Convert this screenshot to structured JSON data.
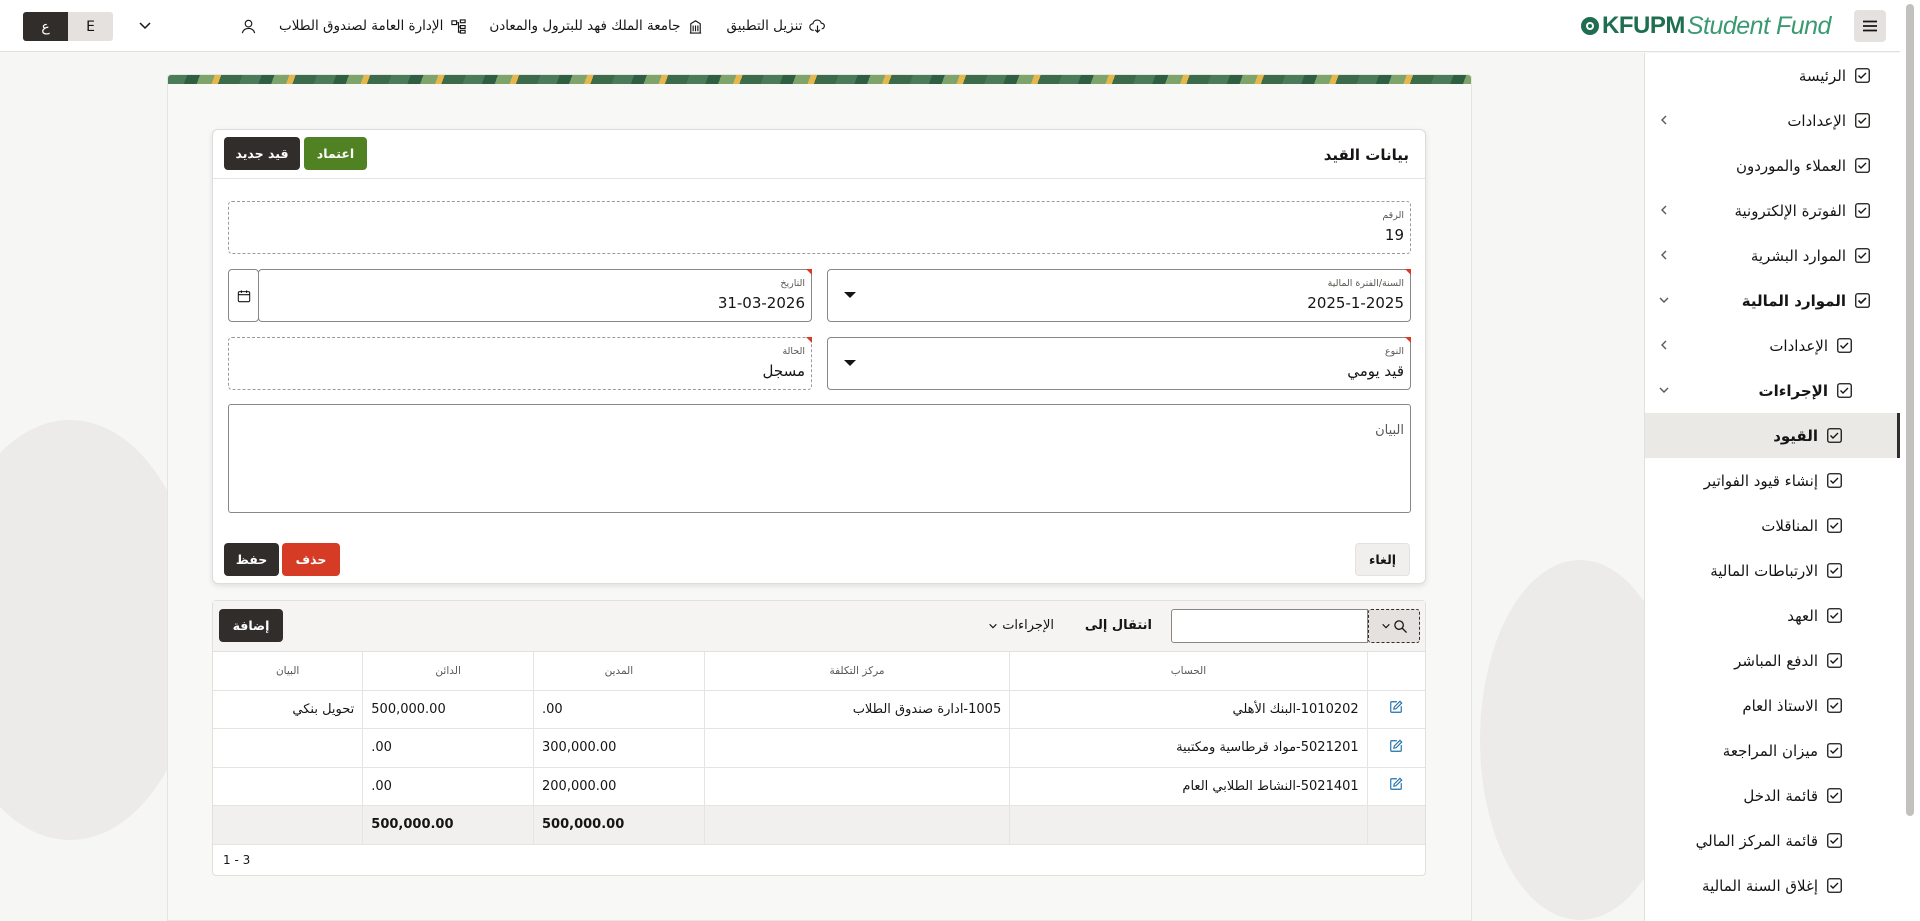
{
  "header": {
    "lang_active": "ع",
    "lang_other": "E",
    "org_label": "الإدارة العامة لصندوق الطلاب",
    "university_label": "جامعة الملك فهد للبترول والمعادن",
    "download_label": "تنزيل التطبيق",
    "logo_primary": "KFUPM",
    "logo_secondary": "Student Fund"
  },
  "sidebar": {
    "items": [
      {
        "label": "الرئيسة"
      },
      {
        "label": "الإعدادات"
      },
      {
        "label": "العملاء والموردون"
      },
      {
        "label": "الفوترة الإلكترونية"
      },
      {
        "label": "الموارد البشرية"
      },
      {
        "label": "الموارد المالية"
      },
      {
        "label": "الإعدادات"
      },
      {
        "label": "الإجراءات"
      },
      {
        "label": "القيود"
      },
      {
        "label": "إنشاء قيود الفواتير"
      },
      {
        "label": "المناقلات"
      },
      {
        "label": "الارتباطات المالية"
      },
      {
        "label": "العهد"
      },
      {
        "label": "الدفع المباشر"
      },
      {
        "label": "الاستاذ العام"
      },
      {
        "label": "ميزان المراجعة"
      },
      {
        "label": "قائمة الدخل"
      },
      {
        "label": "قائمة المركز المالي"
      },
      {
        "label": "إغلاق السنة المالية"
      }
    ]
  },
  "form": {
    "title": "بيانات القيد",
    "approve_button": "اعتماد",
    "new_entry_button": "قيد جديد",
    "number_label": "الرقم",
    "number_value": "19",
    "fiscal_label": "السنة/الفترة المالية",
    "fiscal_value": "2025-1-2025",
    "date_label": "التاريخ",
    "date_value": "31-03-2026",
    "type_label": "النوع",
    "type_value": "قيد يومي",
    "status_label": "الحالة",
    "status_value": "مسجل",
    "description_label": "البيان",
    "cancel_button": "إلغاء",
    "delete_button": "حذف",
    "save_button": "حفظ"
  },
  "grid": {
    "goto_label": "انتقال إلى",
    "actions_label": "الإجراءات",
    "add_button": "إضافة",
    "columns": {
      "account": "الحساب",
      "cost_center": "مركز التكلفة",
      "debit": "المدين",
      "credit": "الدائن",
      "description": "البيان"
    },
    "rows": [
      {
        "account": "1010202-البنك الأهلي",
        "cost_center": "1005-ادارة صندوق الطلاب",
        "debit": ".00",
        "credit": "500,000.00",
        "description": "تحويل بنكي"
      },
      {
        "account": "5021201-مواد قرطاسية ومكتبية",
        "cost_center": "",
        "debit": "300,000.00",
        "credit": ".00",
        "description": ""
      },
      {
        "account": "5021401-النشاط الطلابي العام",
        "cost_center": "",
        "debit": "200,000.00",
        "credit": ".00",
        "description": ""
      }
    ],
    "totals": {
      "debit": "500,000.00",
      "credit": "500,000.00"
    },
    "pagination": "1 - 3"
  },
  "colors": {
    "dark": "#312d2a",
    "green": "#508223",
    "red": "#d63b25",
    "brand": "#1f6e52"
  },
  "icons": {
    "menu": "hamburger-icon",
    "download": "cloud-download-icon",
    "university": "building-icon",
    "org": "org-chart-icon",
    "user": "user-icon",
    "calendar": "calendar-icon",
    "search": "search-icon",
    "edit": "edit-icon"
  }
}
